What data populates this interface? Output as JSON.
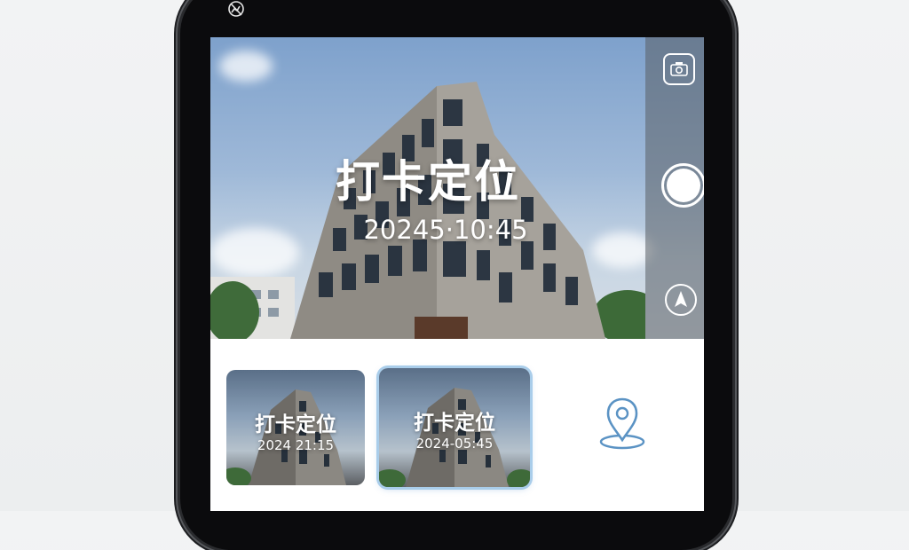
{
  "status_bar": {
    "icon": "no-signal-icon"
  },
  "camera": {
    "overlay_title": "打卡定位",
    "overlay_time": "20245·10:45",
    "controls": [
      "camera-switch-icon",
      "shutter-button",
      "navigation-arrow-icon"
    ]
  },
  "gallery": {
    "thumbnails": [
      {
        "title": "打卡定位",
        "time": "2024 21:15",
        "selected": false
      },
      {
        "title": "打卡定位",
        "time": "2024-05:45",
        "selected": true
      }
    ],
    "location_icon": "location-pin-icon"
  },
  "colors": {
    "accent": "#5b93c4",
    "selection_ring": "#a9cdea",
    "phone_frame": "#0b0b0d"
  }
}
